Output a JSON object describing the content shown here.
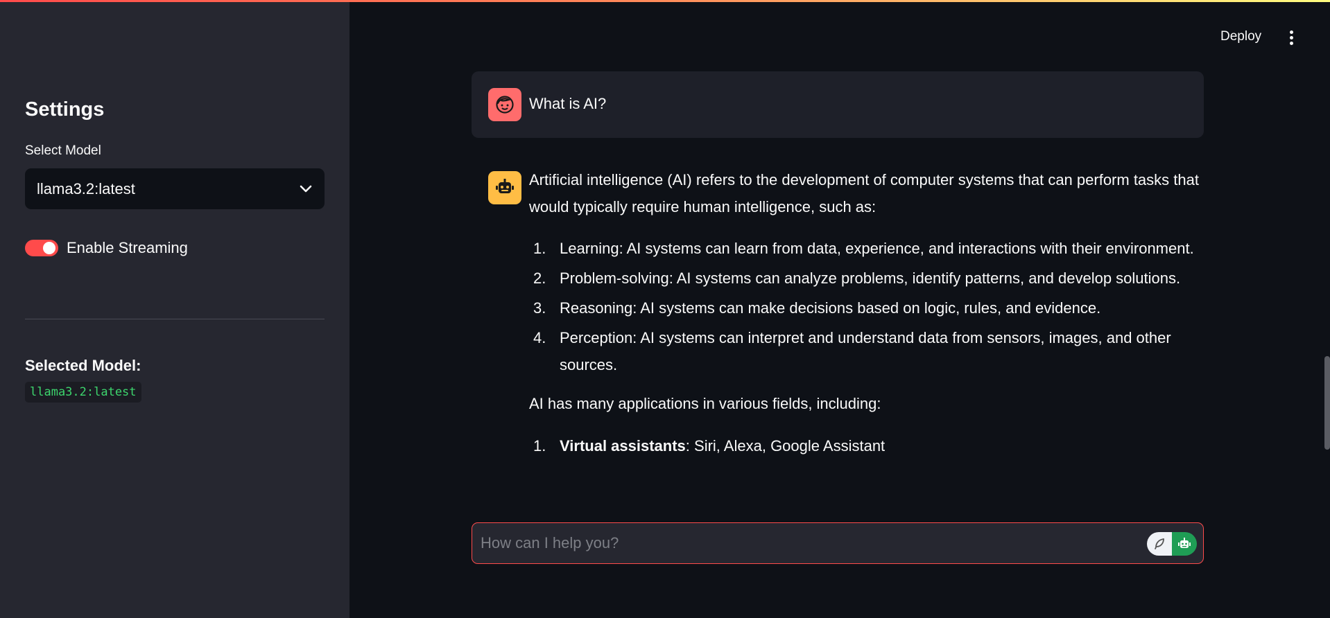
{
  "sidebar": {
    "title": "Settings",
    "select_label": "Select Model",
    "select_value": "llama3.2:latest",
    "toggle_label": "Enable Streaming",
    "toggle_on": true,
    "selected_model_label": "Selected Model:",
    "selected_model_value": "llama3.2:latest"
  },
  "header": {
    "deploy_label": "Deploy"
  },
  "chat": {
    "user_message": "What is AI?",
    "assistant": {
      "intro": "Artificial intelligence (AI) refers to the development of computer systems that can perform tasks that would typically require human intelligence, such as:",
      "list1": [
        {
          "num": "1.",
          "text": "Learning: AI systems can learn from data, experience, and interactions with their environment."
        },
        {
          "num": "2.",
          "text": "Problem-solving: AI systems can analyze problems, identify patterns, and develop solutions."
        },
        {
          "num": "3.",
          "text": "Reasoning: AI systems can make decisions based on logic, rules, and evidence."
        },
        {
          "num": "4.",
          "text": "Perception: AI systems can interpret and understand data from sensors, images, and other sources."
        }
      ],
      "para2": "AI has many applications in various fields, including:",
      "list2": [
        {
          "num": "1.",
          "bold": "Virtual assistants",
          "text": ": Siri, Alexa, Google Assistant"
        }
      ]
    }
  },
  "input": {
    "placeholder": "How can I help you?",
    "value": ""
  },
  "colors": {
    "accent": "#ff4b4b",
    "sidebar_bg": "#262730",
    "main_bg": "#0e1117",
    "user_avatar": "#ff6c6c",
    "bot_avatar": "#ffbd45",
    "code_text": "#3dd56d"
  },
  "icons": {
    "user_avatar": "face-icon",
    "bot_avatar": "robot-icon",
    "select_chevron": "chevron-down-icon",
    "menu": "kebab-menu-icon",
    "input_left": "feather-icon",
    "input_right": "robot-icon"
  }
}
